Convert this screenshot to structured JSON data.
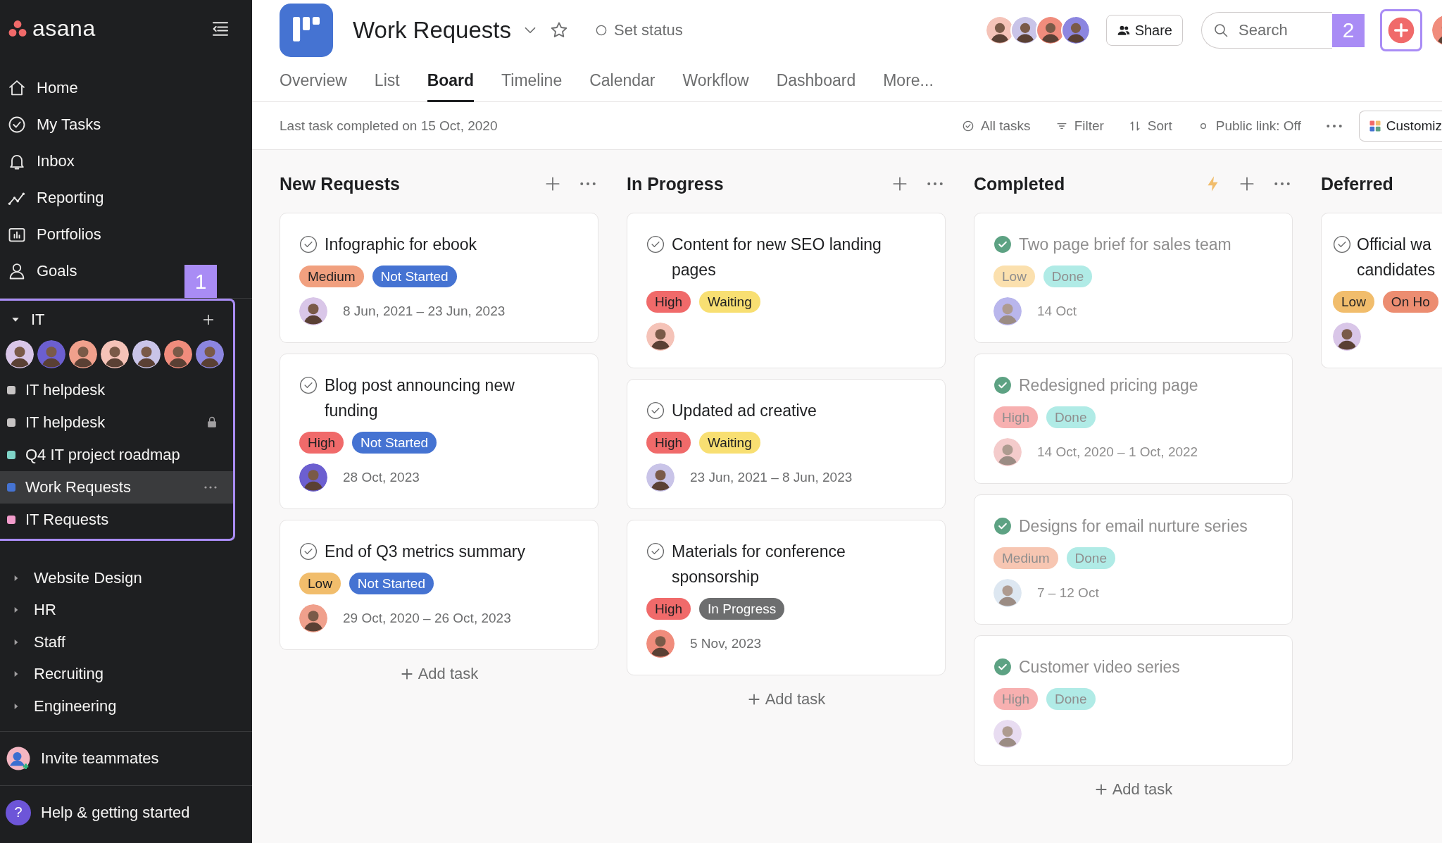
{
  "sidebar": {
    "logo": "asana",
    "nav": [
      {
        "label": "Home"
      },
      {
        "label": "My Tasks"
      },
      {
        "label": "Inbox"
      },
      {
        "label": "Reporting"
      },
      {
        "label": "Portfolios"
      },
      {
        "label": "Goals"
      }
    ],
    "callout": "1",
    "team": {
      "name": "IT",
      "expanded": true,
      "projects": [
        {
          "name": "IT helpdesk",
          "color": "#c7c4c4",
          "selected": false,
          "locked": false
        },
        {
          "name": "IT helpdesk",
          "color": "#c7c4c4",
          "selected": false,
          "locked": true
        },
        {
          "name": "Q4 IT project roadmap",
          "color": "#7fd4c8",
          "selected": false,
          "locked": false
        },
        {
          "name": "Work Requests",
          "color": "#4573d2",
          "selected": true,
          "locked": false
        },
        {
          "name": "IT Requests",
          "color": "#f29ccb",
          "selected": false,
          "locked": false
        }
      ]
    },
    "teams": [
      {
        "name": "Website Design",
        "expanded": false
      },
      {
        "name": "HR",
        "expanded": false
      },
      {
        "name": "Staff",
        "expanded": false
      },
      {
        "name": "Recruiting",
        "expanded": false
      },
      {
        "name": "Engineering",
        "expanded": false
      }
    ],
    "invite": "Invite teammates",
    "help_icon": "?",
    "help": "Help & getting started"
  },
  "header": {
    "title": "Work Requests",
    "status": "Set status",
    "share": "Share",
    "search": {
      "placeholder": "Search"
    },
    "callout": "2",
    "tabs": [
      {
        "label": "Overview",
        "selected": false
      },
      {
        "label": "List",
        "selected": false
      },
      {
        "label": "Board",
        "selected": true
      },
      {
        "label": "Timeline",
        "selected": false
      },
      {
        "label": "Calendar",
        "selected": false
      },
      {
        "label": "Workflow",
        "selected": false
      },
      {
        "label": "Dashboard",
        "selected": false
      },
      {
        "label": "More...",
        "selected": false
      }
    ]
  },
  "toolbar": {
    "last_completed": "Last task completed on 15 Oct, 2020",
    "actions": [
      {
        "label": "All tasks"
      },
      {
        "label": "Filter"
      },
      {
        "label": "Sort"
      },
      {
        "label": "Public link: Off"
      }
    ],
    "customize": "Customiz"
  },
  "columns": [
    {
      "title": "New Requests",
      "add_task": "Add task",
      "cards": [
        {
          "title": "Infographic for ebook",
          "completed": false,
          "tags": [
            {
              "label": "Medium",
              "color": "#f1a07f"
            },
            {
              "label": "Not Started",
              "color": "#4573d2"
            }
          ],
          "date": "8 Jun, 2021 – 23 Jun, 2023"
        },
        {
          "title": "Blog post announcing new funding",
          "completed": false,
          "tags": [
            {
              "label": "High",
              "color": "#f06a6a"
            },
            {
              "label": "Not Started",
              "color": "#4573d2"
            }
          ],
          "date": "28 Oct, 2023"
        },
        {
          "title": "End of Q3 metrics summary",
          "completed": false,
          "tags": [
            {
              "label": "Low",
              "color": "#f1bd6c"
            },
            {
              "label": "Not Started",
              "color": "#4573d2"
            }
          ],
          "date": "29 Oct, 2020 – 26 Oct, 2023"
        }
      ]
    },
    {
      "title": "In Progress",
      "add_task": "Add task",
      "cards": [
        {
          "title": "Content for new SEO landing pages",
          "completed": false,
          "tags": [
            {
              "label": "High",
              "color": "#f06a6a"
            },
            {
              "label": "Waiting",
              "color": "#f8df72"
            }
          ]
        },
        {
          "title": "Updated ad creative",
          "completed": false,
          "tags": [
            {
              "label": "High",
              "color": "#f06a6a"
            },
            {
              "label": "Waiting",
              "color": "#f8df72"
            }
          ],
          "date": "23 Jun, 2021 – 8 Jun, 2023"
        },
        {
          "title": "Materials for conference sponsorship",
          "completed": false,
          "tags": [
            {
              "label": "High",
              "color": "#f06a6a"
            },
            {
              "label": "In Progress",
              "color": "#6d6e6f"
            }
          ],
          "date": "5 Nov, 2023"
        }
      ]
    },
    {
      "title": "Completed",
      "rule": true,
      "add_task": "Add task",
      "cards": [
        {
          "title": "Two page brief for sales team",
          "completed": true,
          "tags": [
            {
              "label": "Low",
              "color": "#fbe0ae"
            },
            {
              "label": "Done",
              "color": "#b0ebe6"
            }
          ],
          "date": "14 Oct"
        },
        {
          "title": "Redesigned pricing page",
          "completed": true,
          "tags": [
            {
              "label": "High",
              "color": "#f7b0b0"
            },
            {
              "label": "Done",
              "color": "#b0ebe6"
            }
          ],
          "date": "14 Oct, 2020 – 1 Oct, 2022"
        },
        {
          "title": "Designs for email nurture series",
          "completed": true,
          "tags": [
            {
              "label": "Medium",
              "color": "#f7c6b2"
            },
            {
              "label": "Done",
              "color": "#b0ebe6"
            }
          ],
          "date": "7 – 12 Oct"
        },
        {
          "title": "Customer video series",
          "completed": true,
          "tags": [
            {
              "label": "High",
              "color": "#f7b0b0"
            },
            {
              "label": "Done",
              "color": "#b0ebe6"
            }
          ]
        }
      ]
    },
    {
      "title": "Deferred",
      "cards": [
        {
          "title": "Official wa candidates",
          "completed": false,
          "tags": [
            {
              "label": "Low",
              "color": "#f1bd6c"
            },
            {
              "label": "On Ho",
              "color": "#ec8d71"
            }
          ]
        }
      ]
    }
  ]
}
